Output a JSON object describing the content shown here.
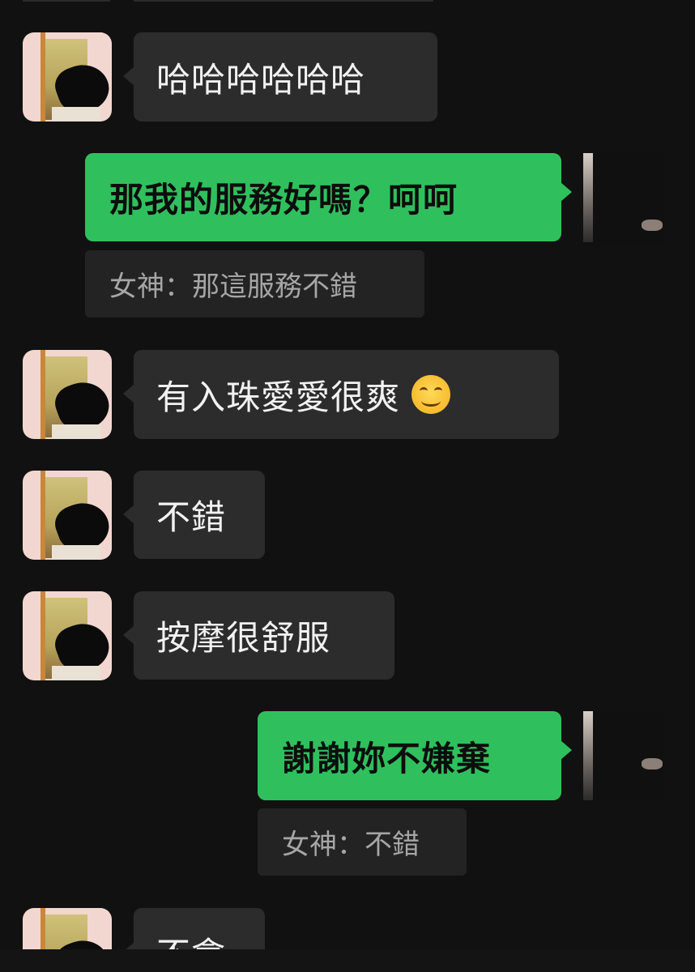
{
  "messages": [
    {
      "side": "in",
      "text": "哈哈哈哈哈哈"
    },
    {
      "side": "out",
      "text": "那我的服務好嗎？呵呵",
      "quote": "女神：那這服務不錯"
    },
    {
      "side": "in",
      "text": "有入珠愛愛很爽",
      "emoji": "smiling-face-emoji"
    },
    {
      "side": "in",
      "text": "不錯"
    },
    {
      "side": "in",
      "text": "按摩很舒服"
    },
    {
      "side": "out",
      "text": "謝謝妳不嫌棄",
      "quote": "女神：不錯"
    },
    {
      "side": "in",
      "text": "不會"
    }
  ],
  "colors": {
    "background": "#111111",
    "incoming_bubble": "#2c2c2c",
    "outgoing_bubble": "#2fc05d",
    "quote_background": "#232323",
    "quote_text": "#a6a6a6"
  }
}
